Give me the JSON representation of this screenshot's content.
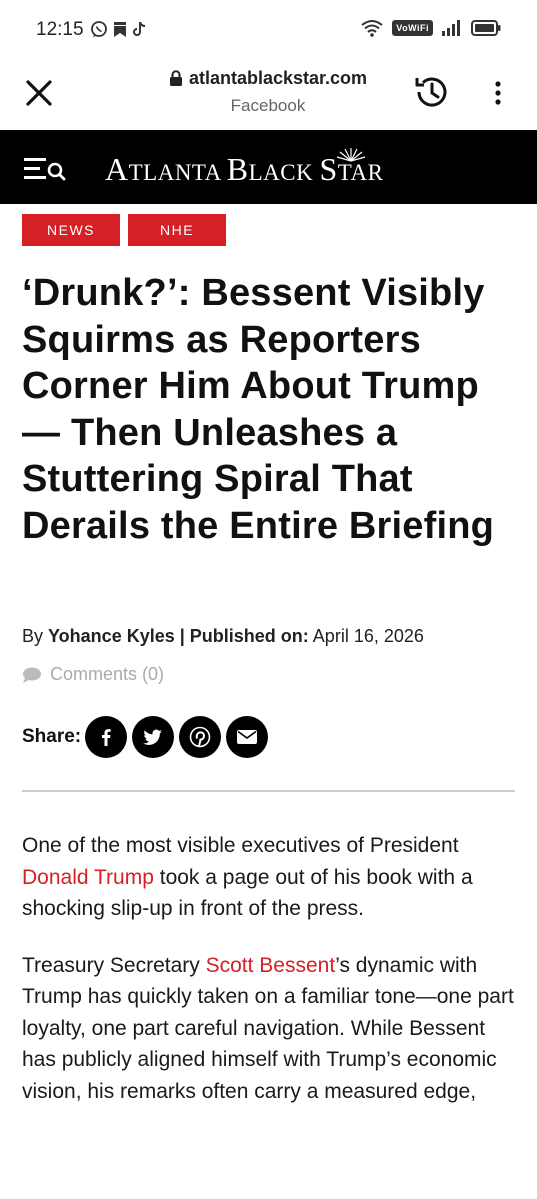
{
  "status_bar": {
    "time": "12:15",
    "network_badge": "VoWiFi"
  },
  "browser": {
    "domain": "atlantablackstar.com",
    "source": "Facebook"
  },
  "site": {
    "logo_first": "A",
    "logo_rest1": "TLANTA ",
    "logo_b": "B",
    "logo_rest2": "LACK ",
    "logo_s": "S",
    "logo_rest3": "TAR"
  },
  "tags": [
    "NEWS",
    "NHE"
  ],
  "article": {
    "headline": "‘Drunk?’: Bessent Visibly Squirms as Reporters Corner Him About Trump — Then Unleashes a Stuttering Spiral That Derails the Entire Briefing",
    "by_prefix": "By ",
    "author": "Yohance Kyles",
    "published_label": " | Published on:",
    "date": " April 16, 2026",
    "comments": "Comments (0)",
    "share_label": "Share:",
    "p1_before": "One of the most visible executives of President ",
    "p1_link": "Donald Trump",
    "p1_after": " took a page out of his book with a shocking slip-up in front of the press.",
    "p2_before": "Treasury Secretary ",
    "p2_link": "Scott Bessent",
    "p2_after": "’s dynamic with Trump has quickly taken on a familiar tone—one part loyalty, one part careful navigation. While Bessent has publicly aligned himself with Trump’s economic vision, his remarks often carry a measured edge,"
  },
  "colors": {
    "accent": "#d42026",
    "header_bg": "#000000"
  },
  "icons": {
    "share": [
      "facebook-icon",
      "twitter-icon",
      "pinterest-icon",
      "email-icon"
    ]
  }
}
